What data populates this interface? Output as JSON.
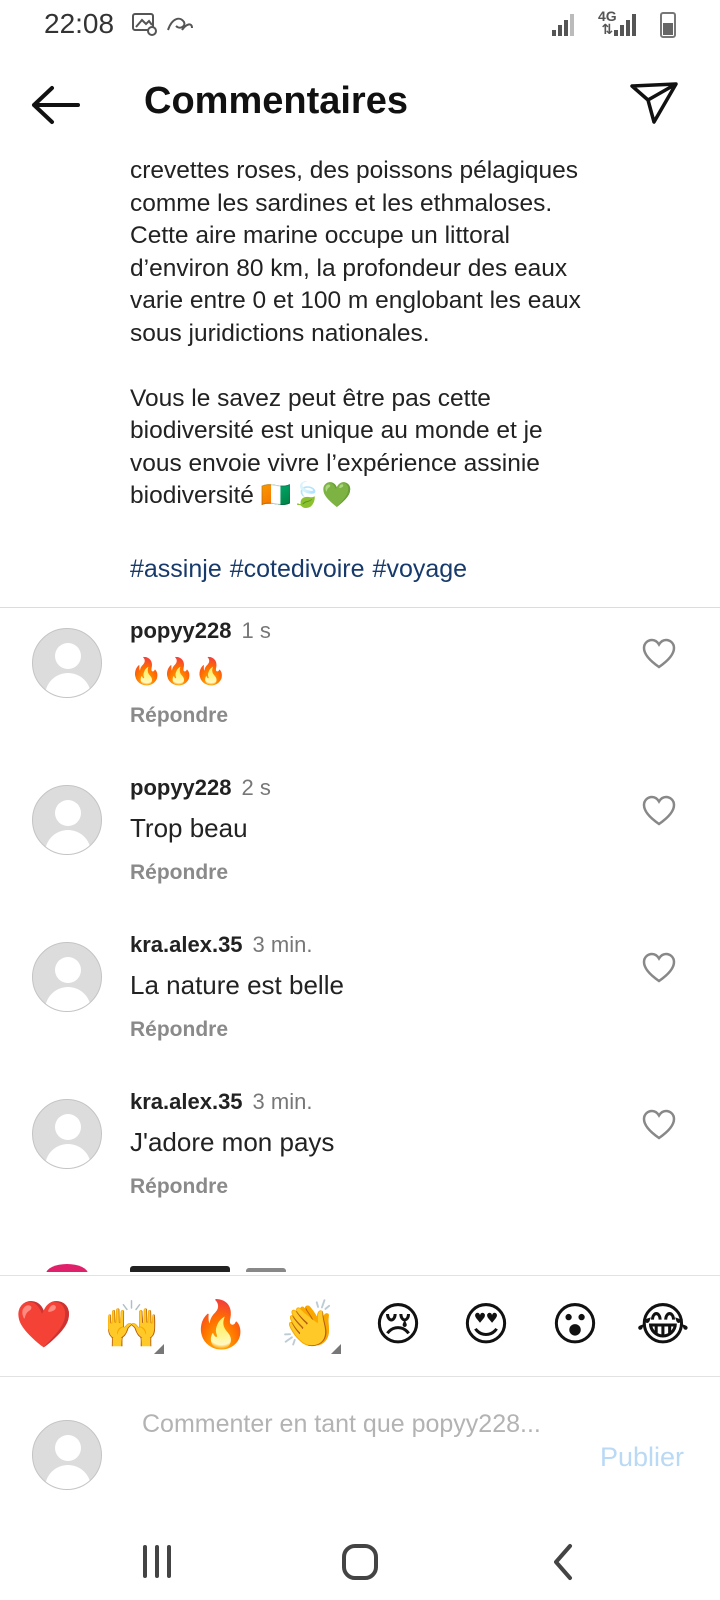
{
  "status_bar": {
    "time": "22:08",
    "network_label_top": "4G",
    "network_label_bottom": "⇅"
  },
  "header": {
    "title": "Commentaires"
  },
  "post": {
    "caption": "crevettes roses, des poissons pélagiques\ncomme les sardines et les ethmaloses.\nCette aire marine occupe un littoral\nd’environ 80 km, la profondeur des eaux\nvarie entre 0 et 100 m englobant les eaux\nsous juridictions nationales.\n\nVous le savez peut être pas cette\nbiodiversité est unique au monde et je\nvous envoie vivre l’expérience assinie\nbiodiversité 🇨🇮🍃💚",
    "hashtags": [
      "#assinje",
      "#cotedivoire",
      "#voyage"
    ]
  },
  "comments": [
    {
      "user": "popyy228",
      "time": "1 s",
      "text": "🔥🔥🔥",
      "reply_label": "Répondre"
    },
    {
      "user": "popyy228",
      "time": "2 s",
      "text": "Trop beau",
      "reply_label": "Répondre"
    },
    {
      "user": "kra.alex.35",
      "time": "3 min.",
      "text": "La nature est belle",
      "reply_label": "Répondre"
    },
    {
      "user": "kra.alex.35",
      "time": "3 min.",
      "text": "J'adore mon pays",
      "reply_label": "Répondre"
    }
  ],
  "emoji_bar": {
    "emojis": [
      "❤️",
      "🙌",
      "🔥",
      "👏",
      "😢",
      "😍",
      "😮",
      "😂"
    ]
  },
  "composer": {
    "placeholder": "Commenter en tant que popyy228...",
    "publish_label": "Publier"
  },
  "colors": {
    "hashtag": "#173a6b",
    "publish_disabled": "#b9d9f5",
    "reply": "#8a8a8a",
    "divider": "#dcdcdc"
  }
}
